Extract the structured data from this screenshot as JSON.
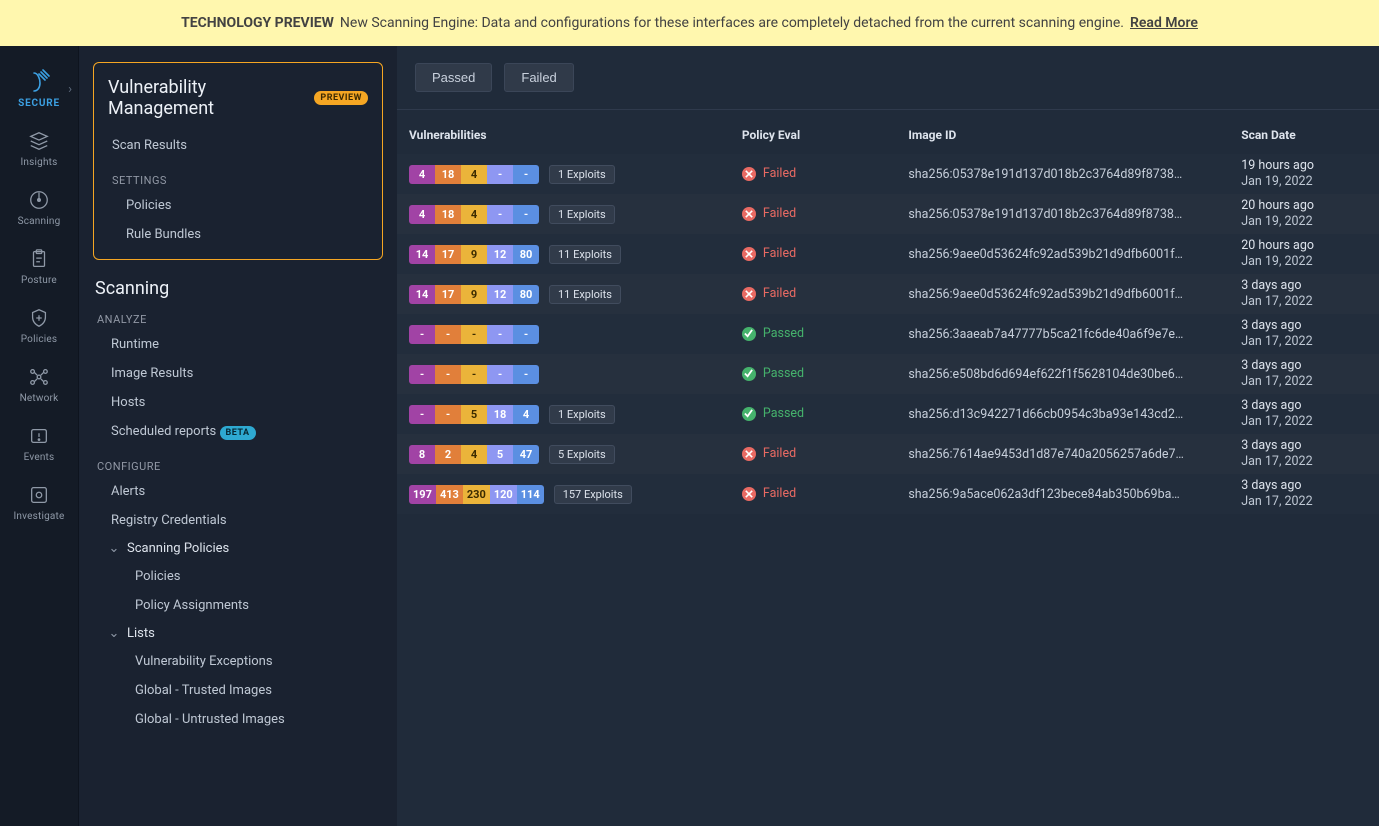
{
  "banner": {
    "badge": "TECHNOLOGY PREVIEW",
    "text": "New Scanning Engine: Data and configurations for these interfaces are completely detached from the current scanning engine.",
    "link": "Read More"
  },
  "rail": [
    {
      "id": "secure",
      "label": "SECURE",
      "active": true,
      "icon": "secure"
    },
    {
      "id": "insights",
      "label": "Insights",
      "icon": "layers"
    },
    {
      "id": "scanning",
      "label": "Scanning",
      "icon": "radar"
    },
    {
      "id": "posture",
      "label": "Posture",
      "icon": "clipboard"
    },
    {
      "id": "policies",
      "label": "Policies",
      "icon": "shield-plus"
    },
    {
      "id": "network",
      "label": "Network",
      "icon": "topology"
    },
    {
      "id": "events",
      "label": "Events",
      "icon": "alert"
    },
    {
      "id": "investigate",
      "label": "Investigate",
      "icon": "target"
    }
  ],
  "sidebar": {
    "vm": {
      "title": "Vulnerability Management",
      "chip": "PREVIEW",
      "items": [
        "Scan Results"
      ],
      "settings_label": "SETTINGS",
      "settings_items": [
        "Policies",
        "Rule Bundles"
      ]
    },
    "scanning": {
      "title": "Scanning",
      "sections": [
        {
          "heading": "ANALYZE",
          "items": [
            {
              "label": "Runtime"
            },
            {
              "label": "Image Results"
            },
            {
              "label": "Hosts"
            },
            {
              "label": "Scheduled reports",
              "chip": "BETA"
            }
          ]
        },
        {
          "heading": "CONFIGURE",
          "items": [
            {
              "label": "Alerts"
            },
            {
              "label": "Registry Credentials"
            },
            {
              "label": "Scanning Policies",
              "expandable": true,
              "children": [
                "Policies",
                "Policy Assignments"
              ]
            },
            {
              "label": "Lists",
              "expandable": true,
              "children": [
                "Vulnerability Exceptions",
                "Global - Trusted Images",
                "Global - Untrusted Images"
              ]
            }
          ]
        }
      ]
    }
  },
  "toolbar": {
    "filters": [
      "Passed",
      "Failed"
    ]
  },
  "table": {
    "columns": [
      "Vulnerabilities",
      "Policy Eval",
      "Image ID",
      "Scan Date"
    ],
    "status": {
      "failed": "Failed",
      "passed": "Passed"
    },
    "exploits_suffix": "Exploits",
    "rows": [
      {
        "sev": [
          "4",
          "18",
          "4",
          "-",
          "-"
        ],
        "exploits": "1",
        "eval": "failed",
        "image": "sha256:05378e191d137d018b2c3764d89f8738…",
        "rel": "19 hours ago",
        "abs": "Jan 19, 2022"
      },
      {
        "sev": [
          "4",
          "18",
          "4",
          "-",
          "-"
        ],
        "exploits": "1",
        "eval": "failed",
        "image": "sha256:05378e191d137d018b2c3764d89f8738…",
        "rel": "20 hours ago",
        "abs": "Jan 19, 2022"
      },
      {
        "sev": [
          "14",
          "17",
          "9",
          "12",
          "80"
        ],
        "exploits": "11",
        "eval": "failed",
        "image": "sha256:9aee0d53624fc92ad539b21d9dfb6001f…",
        "rel": "20 hours ago",
        "abs": "Jan 19, 2022"
      },
      {
        "sev": [
          "14",
          "17",
          "9",
          "12",
          "80"
        ],
        "exploits": "11",
        "eval": "failed",
        "image": "sha256:9aee0d53624fc92ad539b21d9dfb6001f…",
        "rel": "3 days ago",
        "abs": "Jan 17, 2022"
      },
      {
        "sev": [
          "-",
          "-",
          "-",
          "-",
          "-"
        ],
        "exploits": null,
        "eval": "passed",
        "image": "sha256:3aaeab7a47777b5ca21fc6de40a6f9e7e…",
        "rel": "3 days ago",
        "abs": "Jan 17, 2022"
      },
      {
        "sev": [
          "-",
          "-",
          "-",
          "-",
          "-"
        ],
        "exploits": null,
        "eval": "passed",
        "image": "sha256:e508bd6d694ef622f1f5628104de30be6…",
        "rel": "3 days ago",
        "abs": "Jan 17, 2022"
      },
      {
        "sev": [
          "-",
          "-",
          "5",
          "18",
          "4"
        ],
        "exploits": "1",
        "eval": "passed",
        "image": "sha256:d13c942271d66cb0954c3ba93e143cd2…",
        "rel": "3 days ago",
        "abs": "Jan 17, 2022"
      },
      {
        "sev": [
          "8",
          "2",
          "4",
          "5",
          "47"
        ],
        "exploits": "5",
        "eval": "failed",
        "image": "sha256:7614ae9453d1d87e740a2056257a6de7…",
        "rel": "3 days ago",
        "abs": "Jan 17, 2022"
      },
      {
        "sev": [
          "197",
          "413",
          "230",
          "120",
          "114"
        ],
        "exploits": "157",
        "eval": "failed",
        "image": "sha256:9a5ace062a3df123bece84ab350b69ba…",
        "rel": "3 days ago",
        "abs": "Jan 17, 2022"
      }
    ]
  }
}
